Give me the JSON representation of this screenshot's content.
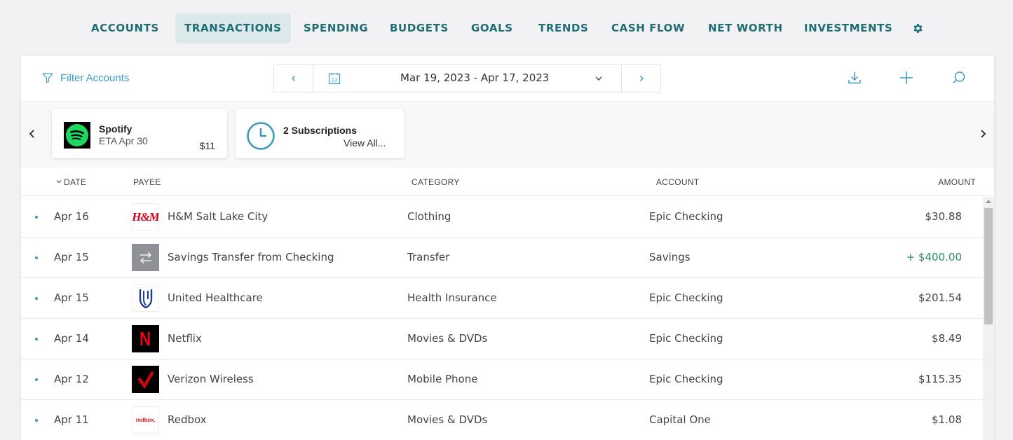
{
  "nav": {
    "accounts": "ACCOUNTS",
    "transactions": "TRANSACTIONS",
    "spending": "SPENDING",
    "budgets": "BUDGETS",
    "goals": "GOALS",
    "trends": "TRENDS",
    "cash_flow": "CASH FLOW",
    "net_worth": "NET WORTH",
    "investments": "INVESTMENTS",
    "active": "TRANSACTIONS",
    "settings_icon": "gear-icon"
  },
  "toolbar": {
    "filter_label": "Filter Accounts",
    "date_range": "Mar 19, 2023 - Apr 17, 2023",
    "calendar_icon_text": "12",
    "icons": [
      "filter-icon",
      "chevron-left-icon",
      "calendar-icon",
      "chevron-down-icon",
      "chevron-right-icon",
      "download-icon",
      "plus-icon",
      "search-icon"
    ]
  },
  "subscriptions": {
    "spotify": {
      "name": "Spotify",
      "eta": "ETA Apr 30",
      "amount": "$11"
    },
    "summary": {
      "title": "2 Subscriptions",
      "link": "View All..."
    }
  },
  "table": {
    "headers": {
      "date": "DATE",
      "payee": "PAYEE",
      "category": "CATEGORY",
      "account": "ACCOUNT",
      "amount": "AMOUNT"
    },
    "rows": [
      {
        "date": "Apr 16",
        "payee": "H&M Salt Lake City",
        "category": "Clothing",
        "account": "Epic Checking",
        "amount": "$30.88",
        "logo": "H&M"
      },
      {
        "date": "Apr 15",
        "payee": "Savings Transfer from Checking",
        "category": "Transfer",
        "account": "Savings",
        "amount": "+ $400.00",
        "logo": "transfer-icon"
      },
      {
        "date": "Apr 15",
        "payee": "United Healthcare",
        "category": "Health Insurance",
        "account": "Epic Checking",
        "amount": "$201.54",
        "logo": "united-healthcare-logo"
      },
      {
        "date": "Apr 14",
        "payee": "Netflix",
        "category": "Movies & DVDs",
        "account": "Epic Checking",
        "amount": "$8.49",
        "logo": "N"
      },
      {
        "date": "Apr 12",
        "payee": "Verizon Wireless",
        "category": "Mobile Phone",
        "account": "Epic Checking",
        "amount": "$115.35",
        "logo": "verizon-check-logo"
      },
      {
        "date": "Apr 11",
        "payee": "Redbox",
        "category": "Movies & DVDs",
        "account": "Capital One",
        "amount": "$1.08",
        "logo": "redbox."
      }
    ]
  },
  "colors": {
    "accent": "#3c9ac2",
    "nav_text": "#1f6e75",
    "nav_active_bg": "#dce9ea",
    "positive": "#2a8a6e",
    "spotify": "#1ed760",
    "netflix": "#e50914",
    "verizon": "#cd040b"
  }
}
